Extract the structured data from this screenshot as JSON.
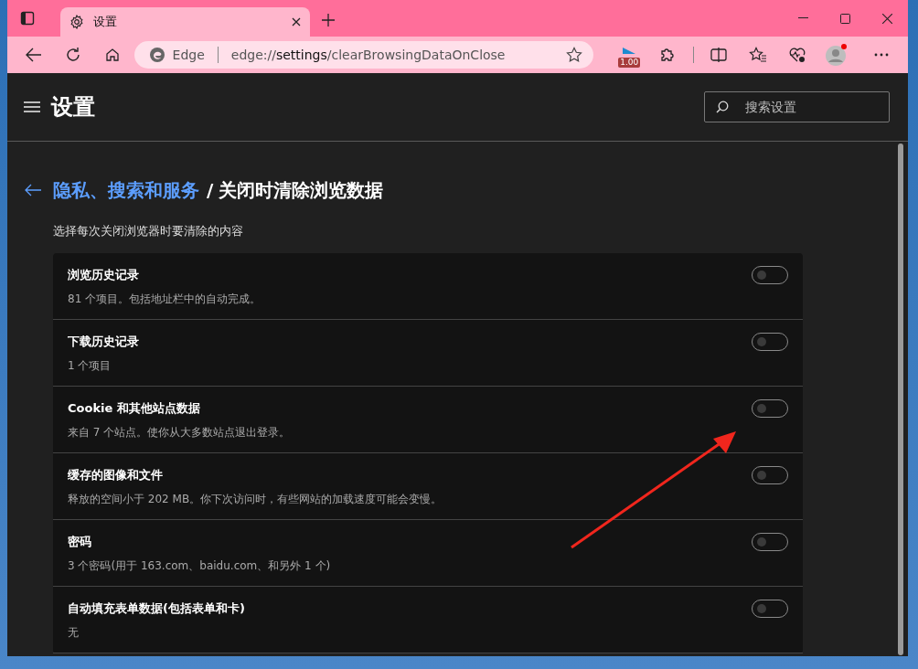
{
  "browser": {
    "tab": {
      "title": "设置"
    },
    "address": {
      "brand": "Edge",
      "url_scheme": "edge://",
      "url_host": "settings",
      "url_path": "/clearBrowsingDataOnClose"
    },
    "extension_badge": "1.00"
  },
  "settings": {
    "title": "设置",
    "search": {
      "placeholder": "搜索设置"
    }
  },
  "breadcrumb": {
    "parent": "隐私、搜索和服务",
    "separator": "/",
    "current": "关闭时清除浏览数据"
  },
  "description": "选择每次关闭浏览器时要清除的内容",
  "options": [
    {
      "title": "浏览历史记录",
      "detail": "81 个项目。包括地址栏中的自动完成。",
      "on": false
    },
    {
      "title": "下载历史记录",
      "detail": "1 个项目",
      "on": false
    },
    {
      "title": "Cookie 和其他站点数据",
      "detail": "来自 7 个站点。使你从大多数站点退出登录。",
      "on": false
    },
    {
      "title": "缓存的图像和文件",
      "detail": "释放的空间小于 202 MB。你下次访问时，有些网站的加载速度可能会变慢。",
      "on": false
    },
    {
      "title": "密码",
      "detail": "3 个密码(用于 163.com、baidu.com、和另外 1 个)",
      "on": false
    },
    {
      "title": "自动填充表单数据(包括表单和卡)",
      "detail": "无",
      "on": false
    }
  ]
}
